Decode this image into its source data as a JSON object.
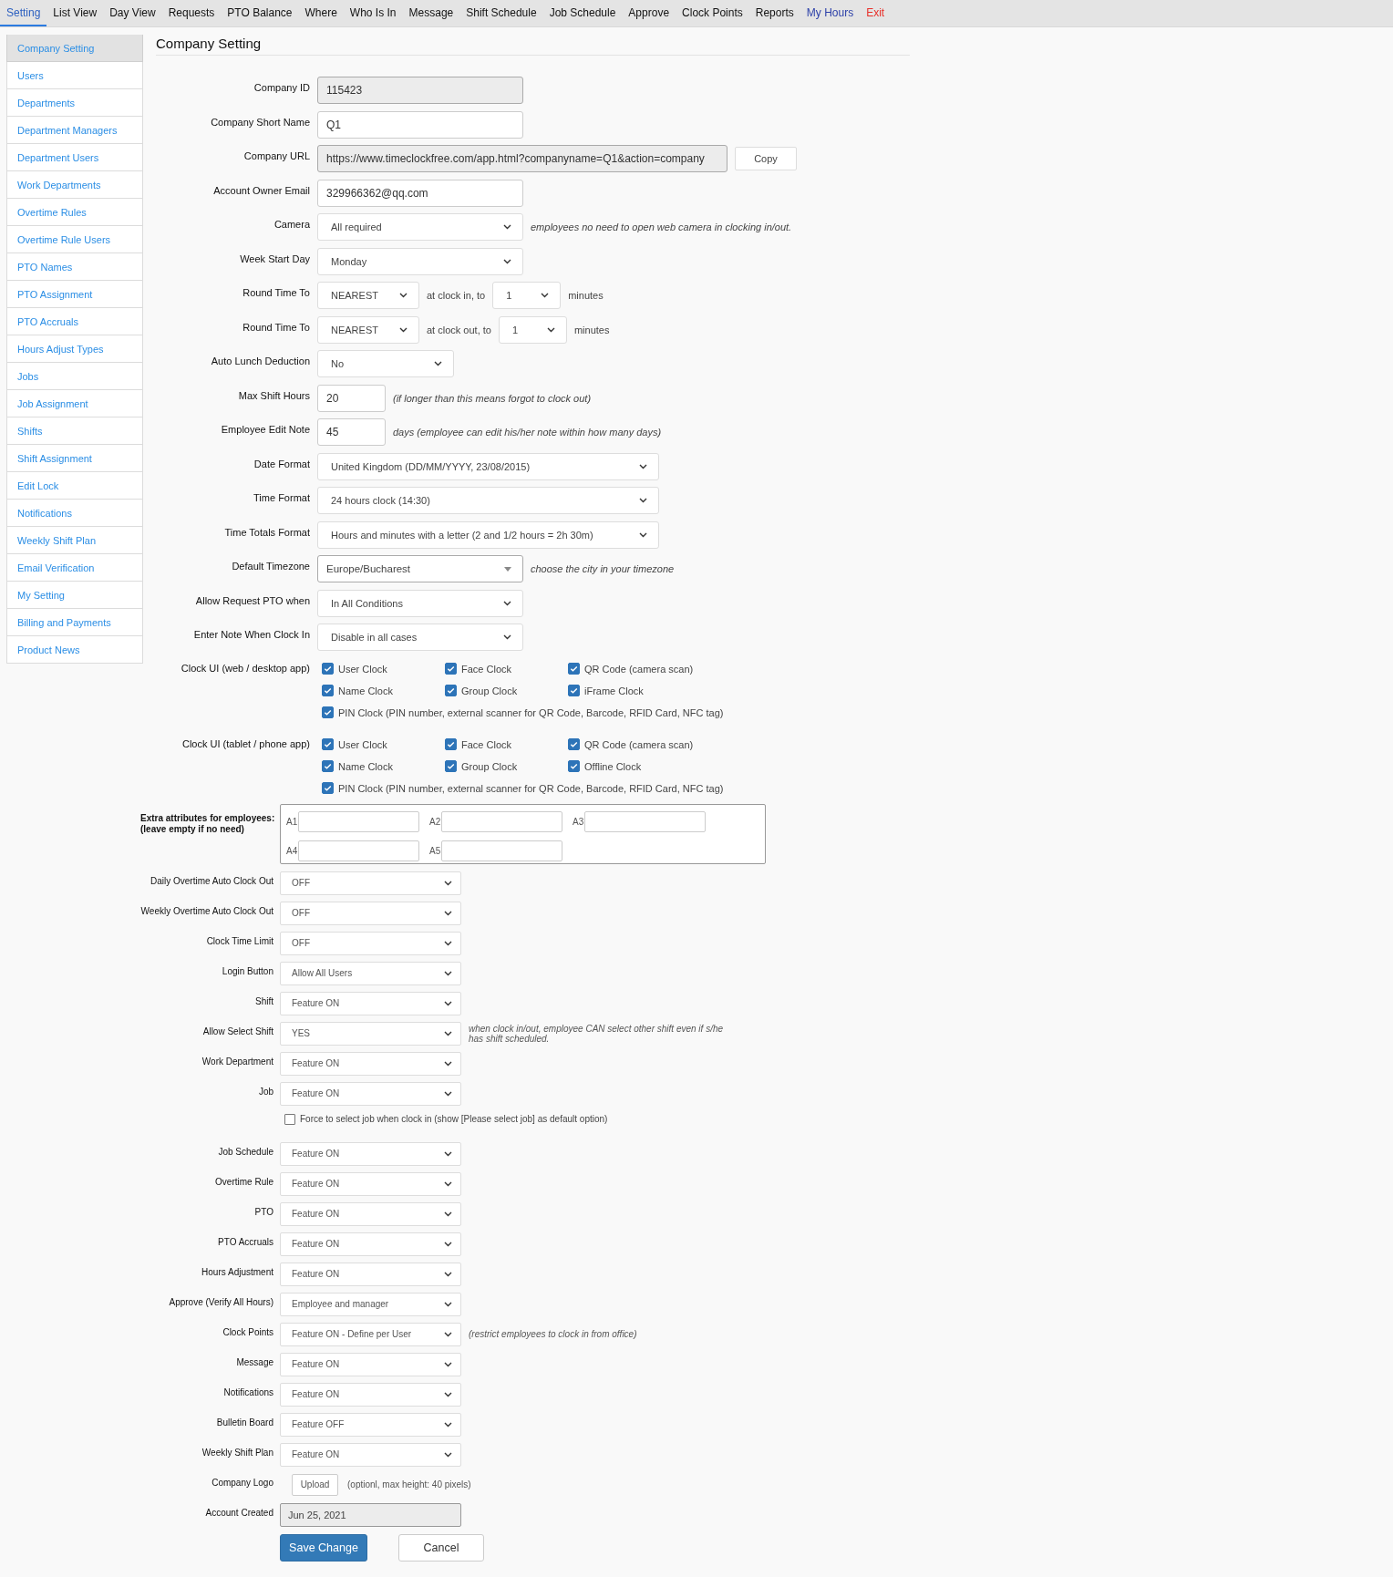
{
  "nav": [
    {
      "label": "Setting",
      "selected": true,
      "kind": "link"
    },
    {
      "label": "List View",
      "selected": false,
      "kind": "link"
    },
    {
      "label": "Day View",
      "selected": false,
      "kind": "link"
    },
    {
      "label": "Requests",
      "selected": false,
      "kind": "link"
    },
    {
      "label": "PTO Balance",
      "selected": false,
      "kind": "link"
    },
    {
      "label": "Where",
      "selected": false,
      "kind": "link"
    },
    {
      "label": "Who Is In",
      "selected": false,
      "kind": "link"
    },
    {
      "label": "Message",
      "selected": false,
      "kind": "link"
    },
    {
      "label": "Shift Schedule",
      "selected": false,
      "kind": "link"
    },
    {
      "label": "Job Schedule",
      "selected": false,
      "kind": "link"
    },
    {
      "label": "Approve",
      "selected": false,
      "kind": "link"
    },
    {
      "label": "Clock Points",
      "selected": false,
      "kind": "link"
    },
    {
      "label": "Reports",
      "selected": false,
      "kind": "link"
    },
    {
      "label": "My Hours",
      "selected": false,
      "kind": "account"
    },
    {
      "label": "Exit",
      "selected": false,
      "kind": "exit"
    }
  ],
  "sidebar": {
    "items": [
      {
        "label": "Company Setting",
        "selected": true
      },
      {
        "label": "Users",
        "selected": false
      },
      {
        "label": "Departments",
        "selected": false
      },
      {
        "label": "Department Managers",
        "selected": false
      },
      {
        "label": "Department Users",
        "selected": false
      },
      {
        "label": "Work Departments",
        "selected": false
      },
      {
        "label": "Overtime Rules",
        "selected": false
      },
      {
        "label": "Overtime Rule Users",
        "selected": false
      },
      {
        "label": "PTO Names",
        "selected": false
      },
      {
        "label": "PTO Assignment",
        "selected": false
      },
      {
        "label": "PTO Accruals",
        "selected": false
      },
      {
        "label": "Hours Adjust Types",
        "selected": false
      },
      {
        "label": "Jobs",
        "selected": false
      },
      {
        "label": "Job Assignment",
        "selected": false
      },
      {
        "label": "Shifts",
        "selected": false
      },
      {
        "label": "Shift Assignment",
        "selected": false
      },
      {
        "label": "Edit Lock",
        "selected": false
      },
      {
        "label": "Notifications",
        "selected": false
      },
      {
        "label": "Weekly Shift Plan",
        "selected": false
      },
      {
        "label": "Email Verification",
        "selected": false
      },
      {
        "label": "My Setting",
        "selected": false
      },
      {
        "label": "Billing and Payments",
        "selected": false
      },
      {
        "label": "Product News",
        "selected": false
      }
    ]
  },
  "title": "Company Setting",
  "settings": [
    {
      "kind": "field",
      "label": "Company ID",
      "value": "115423",
      "readonly": true
    },
    {
      "kind": "field",
      "label": "Company Short Name",
      "value": "Q1",
      "readonly": false
    },
    {
      "kind": "url",
      "label": "Company URL",
      "value": "https://www.timeclockfree.com/app.html?companyname=Q1&action=company",
      "readonly": true,
      "button": "Copy"
    },
    {
      "kind": "field",
      "label": "Account Owner Email",
      "value": "329966362@qq.com",
      "readonly": false
    },
    {
      "kind": "select",
      "label": "Camera",
      "value": "All required",
      "note": "employees no need to open web camera in clocking in/out."
    },
    {
      "kind": "select",
      "label": "Week Start Day",
      "value": "Monday"
    },
    {
      "kind": "round",
      "label": "Round Time To",
      "mode": "NEAREST",
      "text": "at clock in, to",
      "amount": "1",
      "unit": "minutes"
    },
    {
      "kind": "round",
      "label": "Round Time To",
      "mode": "NEAREST",
      "text": "at clock out, to",
      "amount": "1",
      "unit": "minutes"
    },
    {
      "kind": "select-short",
      "label": "Auto Lunch Deduction",
      "value": "No"
    },
    {
      "kind": "number",
      "label": "Max Shift Hours",
      "value": "20",
      "note": "(if longer than this means forgot to clock out)"
    },
    {
      "kind": "number",
      "label": "Employee Edit Note",
      "value": "45",
      "note": "days (employee can edit his/her note within how many days)"
    },
    {
      "kind": "select-wide",
      "label": "Date Format",
      "value": "United Kingdom (DD/MM/YYYY, 23/08/2015)"
    },
    {
      "kind": "select-wide",
      "label": "Time Format",
      "value": "24 hours clock (14:30)"
    },
    {
      "kind": "select-wide",
      "label": "Time Totals Format",
      "value": "Hours and minutes with a letter (2 and 1/2 hours = 2h 30m)"
    },
    {
      "kind": "combo",
      "label": "Default Timezone",
      "value": "Europe/Bucharest",
      "note": "choose the city in your timezone"
    },
    {
      "kind": "select",
      "label": "Allow Request PTO when",
      "value": "In All Conditions"
    },
    {
      "kind": "select",
      "label": "Enter Note When Clock In",
      "value": "Disable in all cases"
    },
    {
      "kind": "checks",
      "label": "Clock UI (web / desktop app)",
      "options": [
        {
          "label": "User Clock",
          "checked": true
        },
        {
          "label": "Face Clock",
          "checked": true
        },
        {
          "label": "QR Code (camera scan)",
          "checked": true
        },
        {
          "label": "Name Clock",
          "checked": true
        },
        {
          "label": "Group Clock",
          "checked": true
        },
        {
          "label": "iFrame Clock",
          "checked": true
        },
        {
          "label": "PIN Clock (PIN number, external scanner for QR Code, Barcode, RFID Card, NFC tag)",
          "checked": true
        }
      ]
    },
    {
      "kind": "checks",
      "label": "Clock UI (tablet / phone app)",
      "options": [
        {
          "label": "User Clock",
          "checked": true
        },
        {
          "label": "Face Clock",
          "checked": true
        },
        {
          "label": "QR Code (camera scan)",
          "checked": true
        },
        {
          "label": "Name Clock",
          "checked": true
        },
        {
          "label": "Group Clock",
          "checked": true
        },
        {
          "label": "Offline Clock",
          "checked": true
        },
        {
          "label": "PIN Clock (PIN number, external scanner for QR Code, Barcode, RFID Card, NFC tag)",
          "checked": true
        }
      ]
    }
  ],
  "extra_attributes": {
    "label": "Extra attributes for employees:",
    "hint": "(leave empty if no need)",
    "fields": [
      "A1",
      "A2",
      "A3",
      "A4",
      "A5"
    ]
  },
  "features": [
    {
      "kind": "select",
      "label": "Daily Overtime Auto Clock Out",
      "value": "OFF"
    },
    {
      "kind": "select",
      "label": "Weekly Overtime Auto Clock Out",
      "value": "OFF"
    },
    {
      "kind": "select",
      "label": "Clock Time Limit",
      "value": "OFF"
    },
    {
      "kind": "select",
      "label": "Login Button",
      "value": "Allow All Users"
    },
    {
      "kind": "select",
      "label": "Shift",
      "value": "Feature ON"
    },
    {
      "kind": "select",
      "label": "Allow Select Shift",
      "value": "YES",
      "note": "when clock in/out, employee CAN select other shift even if s/he has shift scheduled."
    },
    {
      "kind": "select",
      "label": "Work Department",
      "value": "Feature ON"
    },
    {
      "kind": "select",
      "label": "Job",
      "value": "Feature ON"
    },
    {
      "kind": "checkbox",
      "label": "Force to select job when clock in (show [Please select job] as default option)",
      "checked": false
    },
    {
      "kind": "select",
      "label": "Job Schedule",
      "value": "Feature ON"
    },
    {
      "kind": "select",
      "label": "Overtime Rule",
      "value": "Feature ON"
    },
    {
      "kind": "select",
      "label": "PTO",
      "value": "Feature ON"
    },
    {
      "kind": "select",
      "label": "PTO Accruals",
      "value": "Feature ON"
    },
    {
      "kind": "select",
      "label": "Hours Adjustment",
      "value": "Feature ON"
    },
    {
      "kind": "select",
      "label": "Approve (Verify All Hours)",
      "value": "Employee and manager"
    },
    {
      "kind": "select",
      "label": "Clock Points",
      "value": "Feature ON - Define per User",
      "note": "(restrict employees to clock in from office)"
    },
    {
      "kind": "select",
      "label": "Message",
      "value": "Feature ON"
    },
    {
      "kind": "select",
      "label": "Notifications",
      "value": "Feature ON"
    },
    {
      "kind": "select",
      "label": "Bulletin Board",
      "value": "Feature OFF"
    },
    {
      "kind": "select",
      "label": "Weekly Shift Plan",
      "value": "Feature ON"
    },
    {
      "kind": "upload",
      "label": "Company Logo",
      "button": "Upload",
      "note": "(optionl, max height: 40 pixels)"
    },
    {
      "kind": "readonly",
      "label": "Account Created",
      "value": "Jun 25, 2021"
    }
  ],
  "buttons": [
    {
      "label": "Save Change",
      "kind": "primary"
    },
    {
      "label": "Cancel",
      "kind": "default"
    }
  ]
}
